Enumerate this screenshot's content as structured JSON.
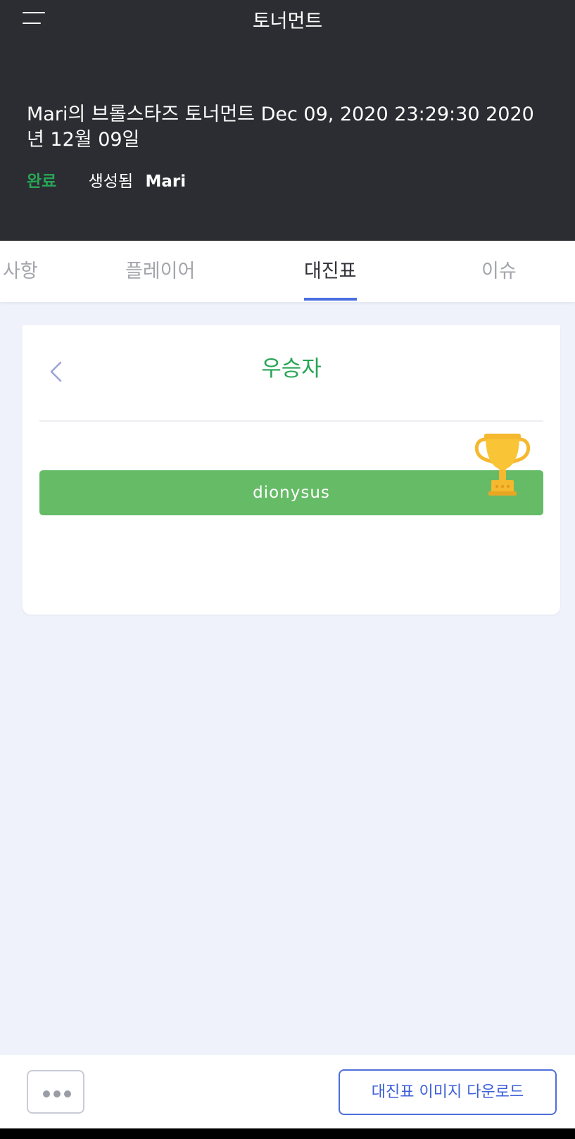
{
  "header": {
    "app_title": "토너먼트",
    "tournament_title": "Mari의 브롤스타즈 토너먼트 Dec 09, 2020 23:29:30 2020년 12월 09일",
    "status": "완료",
    "created_label": "생성됨",
    "author": "Mari",
    "status_color": "#27a556"
  },
  "tabs": [
    {
      "label": "사항",
      "active": false
    },
    {
      "label": "플레이어",
      "active": false
    },
    {
      "label": "대진표",
      "active": true
    },
    {
      "label": "이슈",
      "active": false
    }
  ],
  "bracket": {
    "round_title": "우승자",
    "winner": "dionysus",
    "winner_color": "#66bb67",
    "icons": [
      "chevron-left-icon",
      "trophy-icon"
    ]
  },
  "footer": {
    "more_icon": "more-icon",
    "download_label": "대진표 이미지 다운로드",
    "accent_color": "#4f6fdc"
  }
}
